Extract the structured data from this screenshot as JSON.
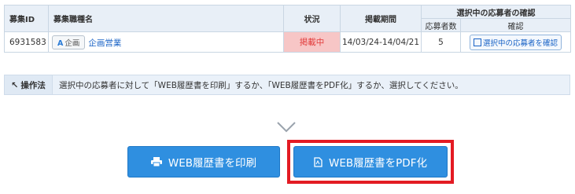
{
  "table": {
    "headers": {
      "id": "募集ID",
      "job_name": "募集職種名",
      "status": "状況",
      "period": "掲載期間",
      "confirm_group": "選択中の応募者の確認",
      "applicant_count": "応募者数",
      "confirm": "確認"
    },
    "row": {
      "id": "6931583",
      "tag_letter": "A",
      "tag_label": "企画",
      "job_name": "企画営業",
      "status": "掲載中",
      "period": "14/03/24-14/04/21",
      "applicant_count": "5",
      "confirm_button": "選択中の応募者を確認"
    }
  },
  "operation": {
    "label": "操作法",
    "text": "選択中の応募者に対して「WEB履歴書を印刷」するか、「WEB履歴書をPDF化」するか、選択してください。"
  },
  "buttons": {
    "print": "WEB履歴書を印刷",
    "pdf": "WEB履歴書をPDF化"
  },
  "icons": {
    "print": "printer-icon",
    "pdf": "pdf-file-icon",
    "chevron": "chevron-down-icon",
    "confirm": "window-icon",
    "operation": "cursor-arrow-icon"
  },
  "colors": {
    "header_bg": "#e8eff7",
    "status_bg": "#f7c6c6",
    "status_text": "#e23b3b",
    "button_bg": "#2f8fe0",
    "highlight": "#e31b23"
  }
}
